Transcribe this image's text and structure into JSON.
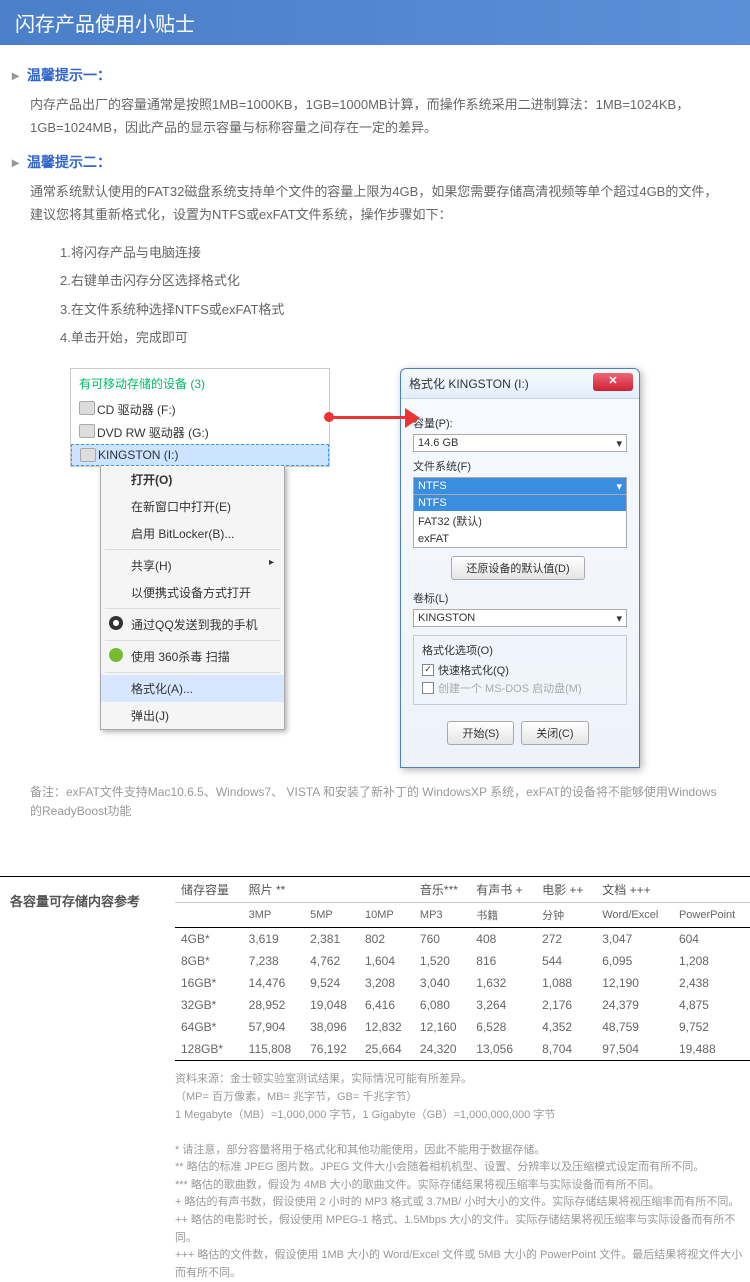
{
  "header": {
    "title": "闪存产品使用小贴士"
  },
  "tip1": {
    "title": "温馨提示一：",
    "body": "内存产品出厂的容量通常是按照1MB=1000KB，1GB=1000MB计算，而操作系统采用二进制算法：1MB=1024KB，1GB=1024MB，因此产品的显示容量与标称容量之间存在一定的差异。"
  },
  "tip2": {
    "title": "温馨提示二：",
    "body": "通常系统默认使用的FAT32磁盘系统支持单个文件的容量上限为4GB，如果您需要存储高清视频等单个超过4GB的文件，建议您将其重新格式化，设置为NTFS或exFAT文件系统，操作步骤如下：",
    "steps": [
      "1.将闪存产品与电脑连接",
      "2.右键单击闪存分区选择格式化",
      "3.在文件系统种选择NTFS或exFAT格式",
      "4.单击开始，完成即可"
    ]
  },
  "explorer": {
    "title": "有可移动存储的设备 (3)",
    "drives": [
      "CD 驱动器 (F:)",
      "DVD RW 驱动器 (G:)",
      "KINGSTON (I:)"
    ],
    "menu": {
      "open": "打开(O)",
      "new_window": "在新窗口中打开(E)",
      "bitlocker": "启用 BitLocker(B)...",
      "share": "共享(H)",
      "portable": "以便携式设备方式打开",
      "qq": "通过QQ发送到我的手机",
      "sec360": "使用 360杀毒 扫描",
      "format": "格式化(A)...",
      "eject": "弹出(J)"
    }
  },
  "dialog": {
    "title": "格式化 KINGSTON (I:)",
    "capacity_label": "容量(P):",
    "capacity_value": "14.6 GB",
    "fs_label": "文件系统(F)",
    "fs_value": "NTFS",
    "fs_options": [
      "NTFS",
      "FAT32 (默认)",
      "exFAT"
    ],
    "restore_btn": "还原设备的默认值(D)",
    "volume_label": "卷标(L)",
    "volume_value": "KINGSTON",
    "options_label": "格式化选项(O)",
    "quick_format": "快速格式化(Q)",
    "msdos": "创建一个 MS-DOS 启动盘(M)",
    "start_btn": "开始(S)",
    "close_btn": "关闭(C)"
  },
  "note": "备注：exFAT文件支持Mac10.6.5、Windows7、 VISTA 和安装了新补丁的 WindowsXP 系统，exFAT的设备将不能够使用Windows的ReadyBoost功能",
  "table": {
    "label": "各容量可存储内容参考",
    "groups": [
      "储存容量",
      "照片 **",
      "音乐***",
      "有声书 +",
      "电影 ++",
      "文档 +++"
    ],
    "sub": [
      "",
      "3MP",
      "5MP",
      "10MP",
      "MP3",
      "书籍",
      "分钟",
      "Word/Excel",
      "PowerPoint"
    ],
    "rows": [
      [
        "4GB*",
        "3,619",
        "2,381",
        "802",
        "760",
        "408",
        "272",
        "3,047",
        "604"
      ],
      [
        "8GB*",
        "7,238",
        "4,762",
        "1,604",
        "1,520",
        "816",
        "544",
        "6,095",
        "1,208"
      ],
      [
        "16GB*",
        "14,476",
        "9,524",
        "3,208",
        "3,040",
        "1,632",
        "1,088",
        "12,190",
        "2,438"
      ],
      [
        "32GB*",
        "28,952",
        "19,048",
        "6,416",
        "6,080",
        "3,264",
        "2,176",
        "24,379",
        "4,875"
      ],
      [
        "64GB*",
        "57,904",
        "38,096",
        "12,832",
        "12,160",
        "6,528",
        "4,352",
        "48,759",
        "9,752"
      ],
      [
        "128GB*",
        "115,808",
        "76,192",
        "25,664",
        "24,320",
        "13,056",
        "8,704",
        "97,504",
        "19,488"
      ]
    ]
  },
  "footnotes": [
    "资料来源：金士顿实验室测试结果，实际情况可能有所差异。",
    "（MP= 百万像素，MB= 兆字节，GB= 千兆字节）",
    "1 Megabyte（MB）=1,000,000 字节，1 Gigabyte（GB）=1,000,000,000 字节",
    "",
    "* 请注意，部分容量将用于格式化和其他功能使用，因此不能用于数据存储。",
    "** 略估的标准 JPEG 图片数。JPEG 文件大小会随着相机机型、设置、分辨率以及压缩模式设定而有所不同。",
    "*** 略估的歌曲数，假设为 4MB 大小的歌曲文件。实际存储结果将视压缩率与实际设备而有所不同。",
    "+ 略估的有声书数，假设使用 2 小时的 MP3 格式或 3.7MB/ 小时大小的文件。实际存储结果将视压缩率而有所不同。",
    "++ 略估的电影时长，假设使用 MPEG-1 格式、1.5Mbps 大小的文件。实际存储结果将视压缩率与实际设备而有所不同。",
    "+++ 略估的文件数，假设使用 1MB 大小的 Word/Excel 文件或 5MB 大小的 PowerPoint 文件。最后结果将视文件大小而有所不同。"
  ]
}
